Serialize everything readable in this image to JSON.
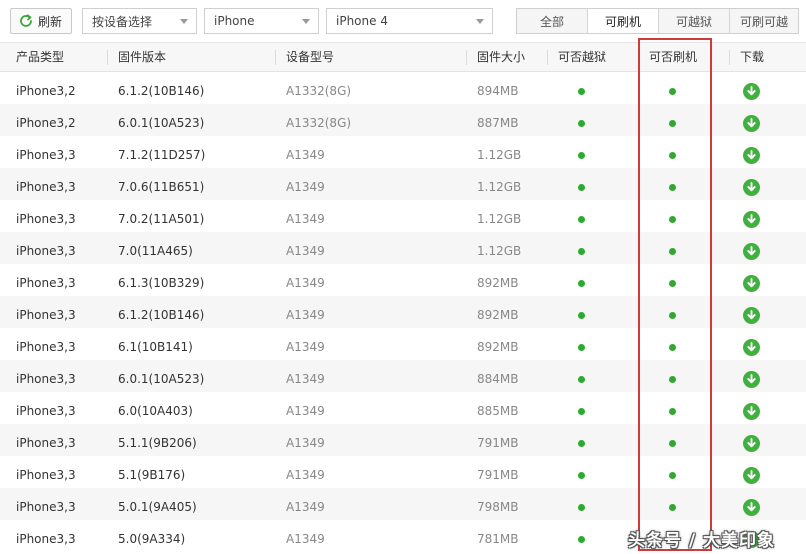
{
  "toolbar": {
    "refresh_label": "刷新",
    "select_mode": "按设备选择",
    "select_category": "iPhone",
    "select_device": "iPhone 4",
    "filters": [
      "全部",
      "可刷机",
      "可越狱",
      "可刷可越"
    ],
    "active_filter": "可刷机"
  },
  "table": {
    "headers": {
      "product": "产品类型",
      "firmware": "固件版本",
      "model": "设备型号",
      "size": "固件大小",
      "jailbreak": "可否越狱",
      "flash": "可否刷机",
      "download": "下载"
    },
    "rows": [
      {
        "product": "iPhone3,2",
        "firmware": "6.1.2(10B146)",
        "model": "A1332(8G)",
        "size": "894MB"
      },
      {
        "product": "iPhone3,2",
        "firmware": "6.0.1(10A523)",
        "model": "A1332(8G)",
        "size": "887MB"
      },
      {
        "product": "iPhone3,3",
        "firmware": "7.1.2(11D257)",
        "model": "A1349",
        "size": "1.12GB"
      },
      {
        "product": "iPhone3,3",
        "firmware": "7.0.6(11B651)",
        "model": "A1349",
        "size": "1.12GB"
      },
      {
        "product": "iPhone3,3",
        "firmware": "7.0.2(11A501)",
        "model": "A1349",
        "size": "1.12GB"
      },
      {
        "product": "iPhone3,3",
        "firmware": "7.0(11A465)",
        "model": "A1349",
        "size": "1.12GB"
      },
      {
        "product": "iPhone3,3",
        "firmware": "6.1.3(10B329)",
        "model": "A1349",
        "size": "892MB"
      },
      {
        "product": "iPhone3,3",
        "firmware": "6.1.2(10B146)",
        "model": "A1349",
        "size": "892MB"
      },
      {
        "product": "iPhone3,3",
        "firmware": "6.1(10B141)",
        "model": "A1349",
        "size": "892MB"
      },
      {
        "product": "iPhone3,3",
        "firmware": "6.0.1(10A523)",
        "model": "A1349",
        "size": "884MB"
      },
      {
        "product": "iPhone3,3",
        "firmware": "6.0(10A403)",
        "model": "A1349",
        "size": "885MB"
      },
      {
        "product": "iPhone3,3",
        "firmware": "5.1.1(9B206)",
        "model": "A1349",
        "size": "791MB"
      },
      {
        "product": "iPhone3,3",
        "firmware": "5.1(9B176)",
        "model": "A1349",
        "size": "791MB"
      },
      {
        "product": "iPhone3,3",
        "firmware": "5.0.1(9A405)",
        "model": "A1349",
        "size": "798MB"
      },
      {
        "product": "iPhone3,3",
        "firmware": "5.0(9A334)",
        "model": "A1349",
        "size": "781MB"
      }
    ],
    "status_color": "#2eaa2e",
    "download_icon": "download-circle-icon"
  },
  "highlight_color": "#d03a3a",
  "watermark": "头条号 / 大美印象"
}
